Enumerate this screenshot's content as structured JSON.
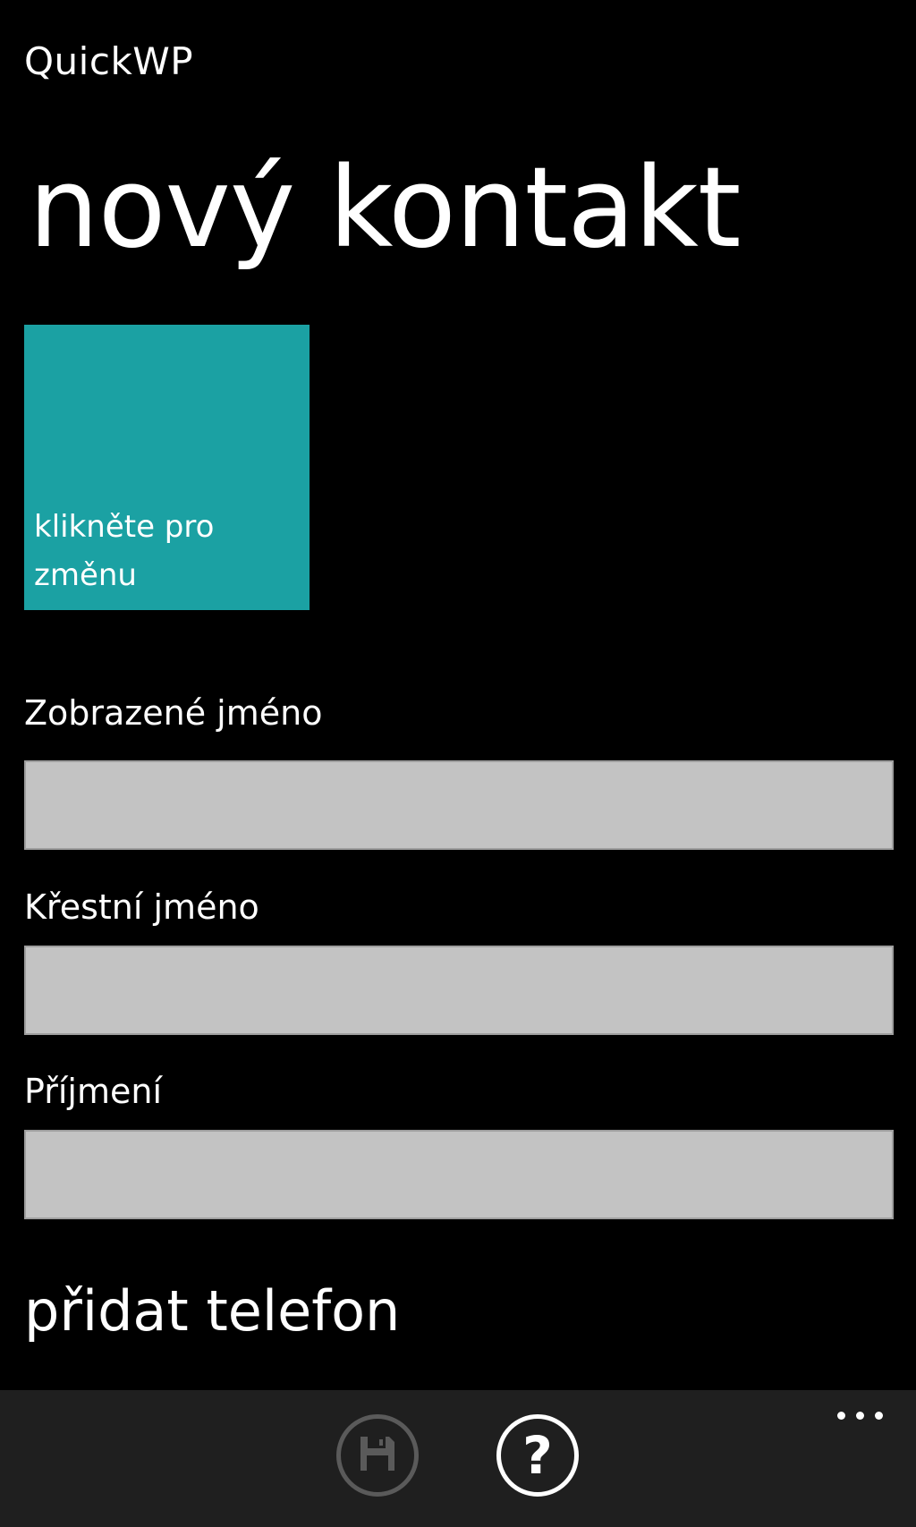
{
  "app": {
    "title": "QuickWP"
  },
  "page": {
    "title": "nový kontakt"
  },
  "photo_tile": {
    "label": "klikněte pro změnu",
    "color": "#1ba1a3"
  },
  "fields": [
    {
      "label": "Zobrazené jméno",
      "value": "",
      "background": "#c3c3c3"
    },
    {
      "label": "Křestní jméno",
      "value": "",
      "background": "#c3c3c3"
    },
    {
      "label": "Příjmení",
      "value": "",
      "background": "#c3c3c3"
    }
  ],
  "add_phone": {
    "label": "přidat telefon"
  },
  "app_bar": {
    "background": "#1f1f1f",
    "buttons": [
      {
        "icon": "save-icon",
        "enabled": false
      },
      {
        "icon": "help-icon",
        "glyph": "?",
        "enabled": true
      }
    ],
    "more_icon": "ellipsis-icon"
  }
}
